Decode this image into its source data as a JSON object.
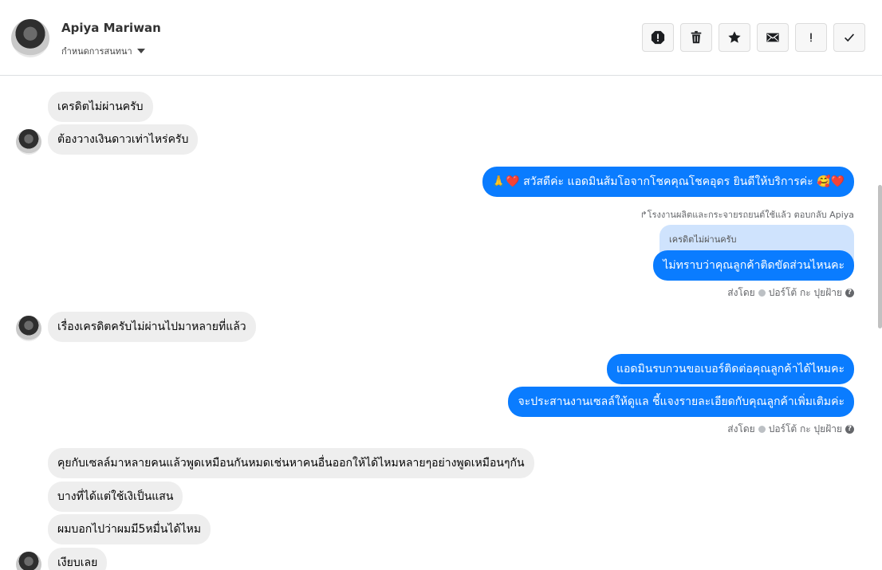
{
  "header": {
    "contact_name": "Apiya Mariwan",
    "assign_label": "กำหนดการสนทนา",
    "actions": [
      "report-icon",
      "trash-icon",
      "star-icon",
      "mail-icon",
      "exclamation-icon",
      "check-icon"
    ]
  },
  "messages": {
    "m1": "เครดิตไม่ผ่านครับ",
    "m2": "ต้องวางเงินดาวเท่าไหร่ครับ",
    "m3": "🙏❤️ สวัสดีค่ะ แอดมินส้มโอจากโชคคุณโชคอุดร ยินดีให้บริการค่ะ 🥰❤️",
    "reply_note": "↱โรงงานผลิตและกระจายรถยนต์ใช้แล้ว ตอบกลับ Apiya",
    "quote": "เครดิตไม่ผ่านครับ",
    "m4": "ไม่ทราบว่าคุณลูกค้าติดขัดส่วนไหนคะ",
    "sent_by_1": "ส่งโดย",
    "sender_1": "ปอร์โต้ กะ ปุยฝ้าย",
    "m5": "เรื่องเครดิตครับไม่ผ่านไปมาหลายที่แล้ว",
    "m6": "แอดมินรบกวนขอเบอร์ติดต่อคุณลูกค้าได้ไหมคะ",
    "m7": "จะประสานงานเซลล์ให้ดูแล ชี้แจงรายละเอียดกับคุณลูกค้าเพิ่มเติมค่ะ",
    "sent_by_2": "ส่งโดย",
    "sender_2": "ปอร์โต้ กะ ปุยฝ้าย",
    "m8": "คุยกับเซลล์มาหลายคนแล้วพูดเหมือนกันหมดเช่นหาคนอื่นออกให้ได้ไหมหลายๆอย่างพูดเหมือนๆกัน",
    "m9": "บางที่ได้แต่ใช้เงิเป็นแสน",
    "m10": "ผมบอกไปว่าผมมี5หมื่นได้ไหม",
    "m11": "เงียบเลย"
  }
}
